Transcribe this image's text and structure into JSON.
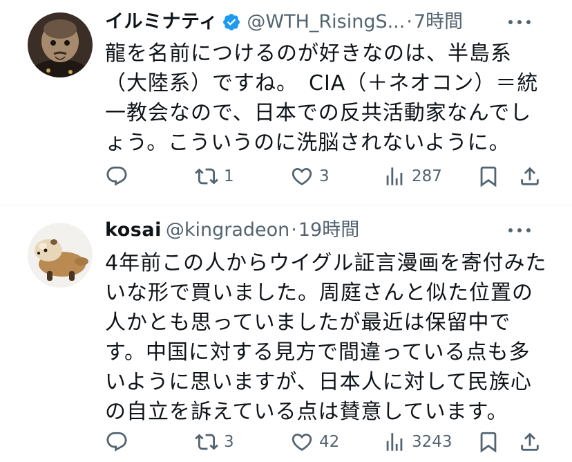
{
  "tweets": [
    {
      "display_name": "イルミナティ",
      "verified": true,
      "handle": "@WTH_RisingS...",
      "separator": "·",
      "time": "7時間",
      "text": "龍を名前につけるのが好きなのは、半島系（大陸系）ですね。　CIA（＋ネオコン）＝統一教会なので、日本での反共活動家なんでしょう。こういうのに洗脳されないように。",
      "counts": {
        "retweets": "1",
        "likes": "3",
        "views": "287"
      }
    },
    {
      "display_name": "kosai",
      "verified": false,
      "handle": "@kingradeon",
      "separator": "·",
      "time": "19時間",
      "text": "4年前この人からウイグル証言漫画を寄付みたいな形で買いました。周庭さんと似た位置の人かとも思っていましたが最近は保留中です。中国に対する見方で間違っている点も多いように思いますが、日本人に対して民族心の自立を訴えている点は賛意しています。",
      "counts": {
        "retweets": "3",
        "likes": "42",
        "views": "3243"
      }
    }
  ],
  "icons": {
    "more": "more-horizontal-icon",
    "verified": "verified-badge-icon",
    "reply": "reply-icon",
    "retweet": "retweet-icon",
    "like": "heart-icon",
    "views": "views-chart-icon",
    "bookmark": "bookmark-icon",
    "share": "share-icon"
  },
  "colors": {
    "text_primary": "#0f1419",
    "text_secondary": "#536471",
    "verified_blue": "#1d9bf0",
    "divider": "#eff3f4"
  }
}
